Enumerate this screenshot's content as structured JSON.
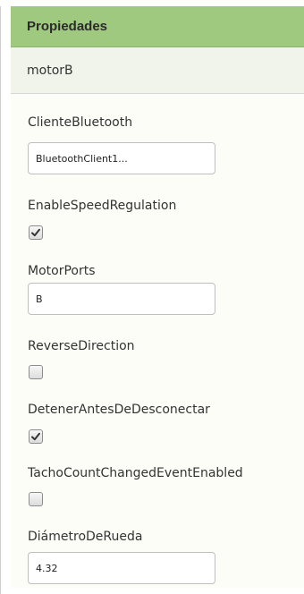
{
  "panel": {
    "title": "Propiedades",
    "component_name": "motorB"
  },
  "properties": [
    {
      "label": "ClienteBluetooth",
      "type": "text",
      "value": "BluetoothClient1..."
    },
    {
      "label": "EnableSpeedRegulation",
      "type": "checkbox",
      "checked": true
    },
    {
      "label": "MotorPorts",
      "type": "text",
      "value": "B"
    },
    {
      "label": "ReverseDirection",
      "type": "checkbox",
      "checked": false
    },
    {
      "label": "DetenerAntesDeDesconectar",
      "type": "checkbox",
      "checked": true
    },
    {
      "label": "TachoCountChangedEventEnabled",
      "type": "checkbox",
      "checked": false
    },
    {
      "label": "DiámetroDeRueda",
      "type": "text",
      "value": "4.32"
    }
  ],
  "icons": {
    "check": "check-mark-icon"
  }
}
